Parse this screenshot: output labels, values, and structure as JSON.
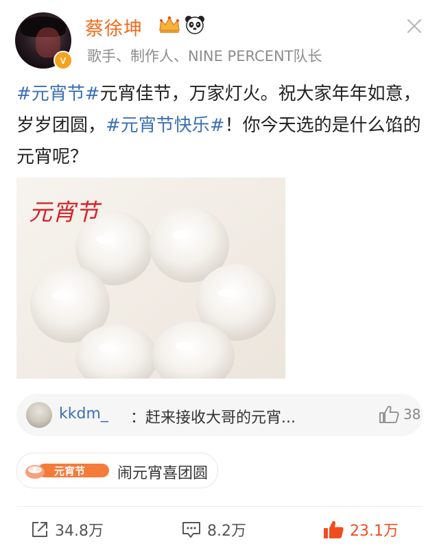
{
  "header": {
    "username": "蔡徐坤",
    "bio": "歌手、制作人、NINE PERCENT队长",
    "verified_badge": "V",
    "icons": [
      "crown-icon",
      "panda-icon",
      "close-icon"
    ]
  },
  "post": {
    "segments": [
      {
        "text": "#元宵节#",
        "type": "hashtag"
      },
      {
        "text": "元宵佳节，万家灯火。祝大家年年如意，岁岁团圆，",
        "type": "text"
      },
      {
        "text": "#元宵节快乐#",
        "type": "hashtag"
      },
      {
        "text": "！你今天选的是什么馅的元宵呢？",
        "type": "text"
      }
    ],
    "image_caption": "元宵节",
    "image_subject": "six white tangyuan dumplings in a bowl"
  },
  "comment": {
    "user": "kkdm_",
    "text": "：赶来接收大哥的元宵...",
    "likes": "38"
  },
  "topic": {
    "badge_text": "元宵节",
    "label": "闹元宵喜团圆"
  },
  "actions": {
    "share_count": "34.8万",
    "comment_count": "8.2万",
    "like_count": "23.1万"
  },
  "colors": {
    "username": "#f26b1d",
    "hashtag": "#3b6fb5",
    "like_active": "#f04d1e",
    "bio": "#8c8c8c"
  }
}
